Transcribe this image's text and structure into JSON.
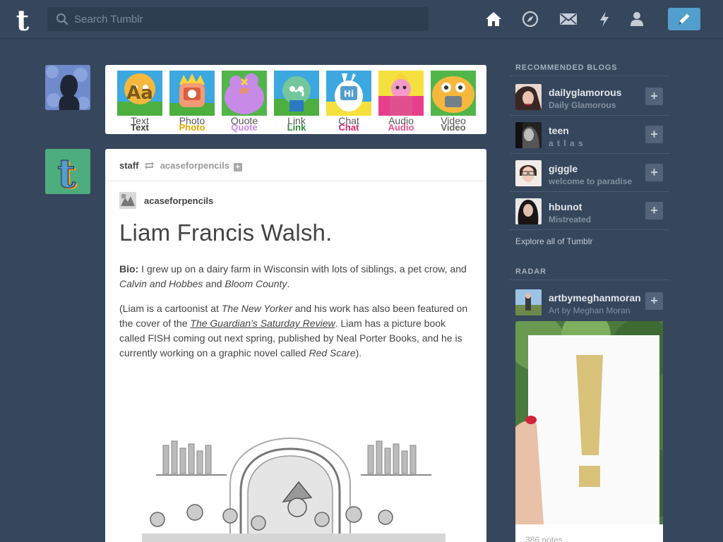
{
  "header": {
    "logo_letter": "t",
    "search_placeholder": "Search Tumblr",
    "nav_icons": [
      "home-icon",
      "explore-compass-icon",
      "inbox-mail-icon",
      "activity-bolt-icon",
      "account-person-icon"
    ],
    "compose_icon": "pencil-icon",
    "accent": "#529ecc"
  },
  "post_types": [
    {
      "label": "Text",
      "label2": "Text",
      "color": "#444444",
      "glyph": "Aa"
    },
    {
      "label": "Photo",
      "label2": "Photo",
      "color": "#d95e40",
      "glyph": ""
    },
    {
      "label": "Quote",
      "label2": "Quote",
      "color": "#f2992e",
      "glyph": ""
    },
    {
      "label": "Link",
      "label2": "Link",
      "color": "#56bc8a",
      "glyph": ""
    },
    {
      "label": "Chat",
      "label2": "Chat",
      "color": "#529ecc",
      "glyph": ""
    },
    {
      "label": "Audio",
      "label2": "Audio",
      "color": "#a77dc2",
      "glyph": ""
    },
    {
      "label": "Video",
      "label2": "Video",
      "color": "#748089",
      "glyph": ""
    }
  ],
  "post": {
    "author": "staff",
    "reblogged_from": "acaseforpencils",
    "source": "acaseforpencils",
    "title": "Liam Francis Walsh.",
    "bio_label": "Bio:",
    "bio_text_1": " I grew up on a dairy farm in Wisconsin with lots of siblings, a pet crow, and ",
    "bio_em_1": "Calvin and Hobbes",
    "bio_text_2": " and ",
    "bio_em_2": "Bloom County",
    "bio_text_3": ".",
    "p2_text_1": "(Liam is a cartoonist at ",
    "p2_em_1": "The New Yorker",
    "p2_text_2": " and his work has also been featured on the cover of the ",
    "p2_link": "The Guardian’s Saturday Review",
    "p2_text_3": ". Liam has a picture book called FISH coming out next spring, published by Neal Porter Books, and he is currently working on a graphic novel called ",
    "p2_em_2": "Red Scare",
    "p2_text_4": ")."
  },
  "sidebar": {
    "recommended_title": "RECOMMENDED BLOGS",
    "blogs": [
      {
        "name": "dailyglamorous",
        "sub": "Daily Glamorous"
      },
      {
        "name": "teen",
        "sub": "a t l a s"
      },
      {
        "name": "giggle",
        "sub": "welcome to paradise"
      },
      {
        "name": "hbunot",
        "sub": "Mistreated"
      }
    ],
    "explore_link": "Explore all of Tumblr",
    "radar_title": "RADAR",
    "radar": {
      "name": "artbymeghanmoran",
      "sub": "Art by Meghan Moran",
      "notes": "386 notes"
    }
  }
}
